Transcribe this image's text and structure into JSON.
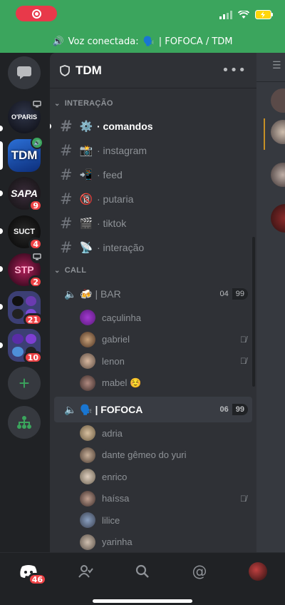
{
  "voice_bar": {
    "text": "Voz conectada:",
    "channel": "| FOFOCA / TDM"
  },
  "server": {
    "name": "TDM",
    "menu": "•••"
  },
  "servers": [
    {
      "label": "O'PARIS",
      "badge": ""
    },
    {
      "label": "TDM",
      "badge": ""
    },
    {
      "label": "SAPA",
      "badge": "9"
    },
    {
      "label": "SUCT",
      "badge": "4"
    },
    {
      "label": "STP",
      "badge": "2"
    },
    {
      "label": "",
      "badge": "21"
    },
    {
      "label": "",
      "badge": "10"
    }
  ],
  "add_server": "+",
  "categories": {
    "interacao": "INTERAÇÃO",
    "call": "CALL"
  },
  "text_channels": [
    {
      "emoji": "⚙️",
      "name": "· comandos"
    },
    {
      "emoji": "📸",
      "name": "· instagram"
    },
    {
      "emoji": "📲",
      "name": "· feed"
    },
    {
      "emoji": "🔞",
      "name": "· putaria"
    },
    {
      "emoji": "🎬",
      "name": "· tiktok"
    },
    {
      "emoji": "📡",
      "name": "· interação"
    }
  ],
  "voice_channels": [
    {
      "emoji": "🍻",
      "name": "| BAR",
      "count": "04",
      "limit": "99",
      "users": [
        "caçulinha",
        "gabriel",
        "lenon",
        "mabel ☺️"
      ]
    },
    {
      "emoji": "🗣️",
      "name": "| FOFOCA",
      "count": "06",
      "limit": "99",
      "users": [
        "adria",
        "dante gêmeo do yuri",
        "enrico",
        "haíssa",
        "lilice",
        "yarinha"
      ]
    }
  ],
  "bottom_nav": {
    "home_badge": "46"
  },
  "colors": {
    "green": "#3ba55d",
    "red": "#ed4245",
    "panel": "#2f3136",
    "rail": "#202225"
  }
}
